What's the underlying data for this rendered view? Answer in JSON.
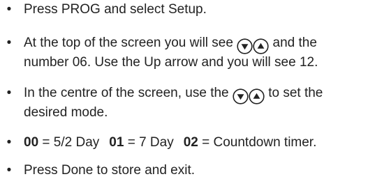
{
  "instructions": {
    "step1": {
      "text": "Press PROG and select Setup."
    },
    "step2": {
      "before_icons": "At the top of the screen you will see",
      "after_icons": "and the",
      "line2": "number 06. Use the Up arrow and you will see 12."
    },
    "step3": {
      "before_icons": "In the centre of the screen, use the",
      "after_icons": "to set the",
      "line2": "desired mode."
    },
    "step4": {
      "modes": [
        {
          "code": "00",
          "label": "= 5/2 Day"
        },
        {
          "code": "01",
          "label": "= 7 Day"
        },
        {
          "code": "02",
          "label": "= Countdown timer."
        }
      ]
    },
    "step5": {
      "text": "Press Done to store and exit."
    }
  },
  "icons": {
    "down": "down-arrow-icon",
    "up": "up-arrow-icon"
  }
}
